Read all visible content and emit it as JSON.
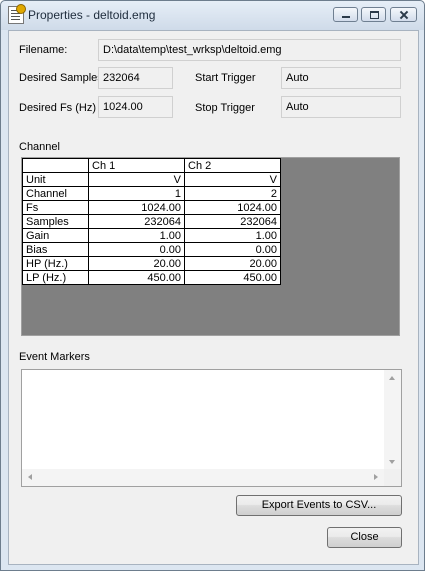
{
  "window": {
    "title": "Properties - deltoid.emg",
    "icon": "properties-document-icon"
  },
  "fields": {
    "filename_label": "Filename:",
    "filename_value": "D:\\data\\temp\\test_wrksp\\deltoid.emg",
    "desired_samples_label": "Desired Samples",
    "desired_samples_value": "232064",
    "start_trigger_label": "Start Trigger",
    "start_trigger_value": "Auto",
    "desired_fs_label": "Desired Fs (Hz)",
    "desired_fs_value": "1024.00",
    "stop_trigger_label": "Stop Trigger",
    "stop_trigger_value": "Auto"
  },
  "channel": {
    "label": "Channel",
    "columns": [
      "Ch 1",
      "Ch 2"
    ],
    "rows": [
      {
        "name": "Unit",
        "values": [
          "V",
          "V"
        ]
      },
      {
        "name": "Channel",
        "values": [
          "1",
          "2"
        ]
      },
      {
        "name": "Fs",
        "values": [
          "1024.00",
          "1024.00"
        ]
      },
      {
        "name": "Samples",
        "values": [
          "232064",
          "232064"
        ]
      },
      {
        "name": "Gain",
        "values": [
          "1.00",
          "1.00"
        ]
      },
      {
        "name": "Bias",
        "values": [
          "0.00",
          "0.00"
        ]
      },
      {
        "name": "HP (Hz.)",
        "values": [
          "20.00",
          "20.00"
        ]
      },
      {
        "name": "LP (Hz.)",
        "values": [
          "450.00",
          "450.00"
        ]
      }
    ]
  },
  "events": {
    "label": "Event Markers"
  },
  "buttons": {
    "export": "Export Events to CSV...",
    "close": "Close"
  }
}
